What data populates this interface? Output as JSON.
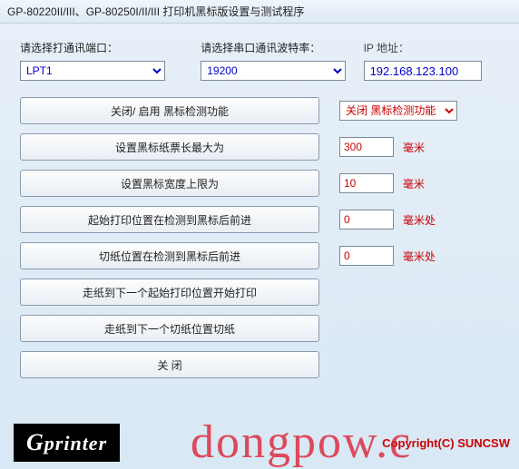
{
  "window": {
    "title": "GP-80220II/III、GP-80250I/II/III 打印机黑标版设置与测试程序"
  },
  "labels": {
    "port": "请选择打通讯端口：",
    "baud": "请选择串口通讯波特率：",
    "ip": "IP 地址："
  },
  "fields": {
    "port_selected": "LPT1",
    "baud_selected": "19200",
    "ip_value": "192.168.123.100",
    "bm_toggle_selected": "关闭 黑标检测功能",
    "ticket_max_len": "300",
    "bm_width_max": "10",
    "print_start_offset": "0",
    "cut_offset": "0"
  },
  "buttons": {
    "toggle_bm": "关闭/ 启用 黑标检测功能",
    "set_max_len": "设置黑标纸票长最大为",
    "set_bm_width": "设置黑标宽度上限为",
    "print_start_advance": "起始打印位置在检测到黑标后前进",
    "cut_advance": "切纸位置在检测到黑标后前进",
    "feed_to_print": "走纸到下一个起始打印位置开始打印",
    "feed_to_cut": "走纸到下一个切纸位置切纸",
    "close": "关 闭"
  },
  "units": {
    "mm": "毫米",
    "mm_at": "毫米处"
  },
  "footer": {
    "logo": "Gprinter",
    "copyright": "Copyright(C) SUNCSW",
    "watermark": "dongpow.c"
  }
}
